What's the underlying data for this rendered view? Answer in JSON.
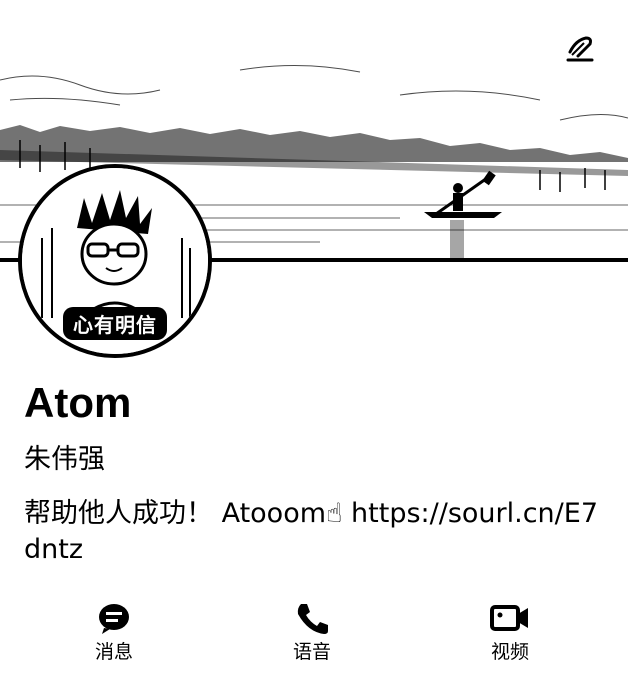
{
  "profile": {
    "display_name": "Atom",
    "real_name": "朱伟强",
    "bio": "帮助他人成功！ Atooom☝ https://sourl.cn/E7dntz",
    "avatar_badge": "心有明信"
  },
  "cover": {
    "scene": "lake-kayak-icon"
  },
  "header": {
    "edit_icon": "edit-pen-icon"
  },
  "actions": [
    {
      "label": "消息",
      "icon": "message-icon"
    },
    {
      "label": "语音",
      "icon": "phone-icon"
    },
    {
      "label": "视频",
      "icon": "video-camera-icon"
    }
  ],
  "colors": {
    "foreground": "#000000",
    "background": "#ffffff"
  }
}
